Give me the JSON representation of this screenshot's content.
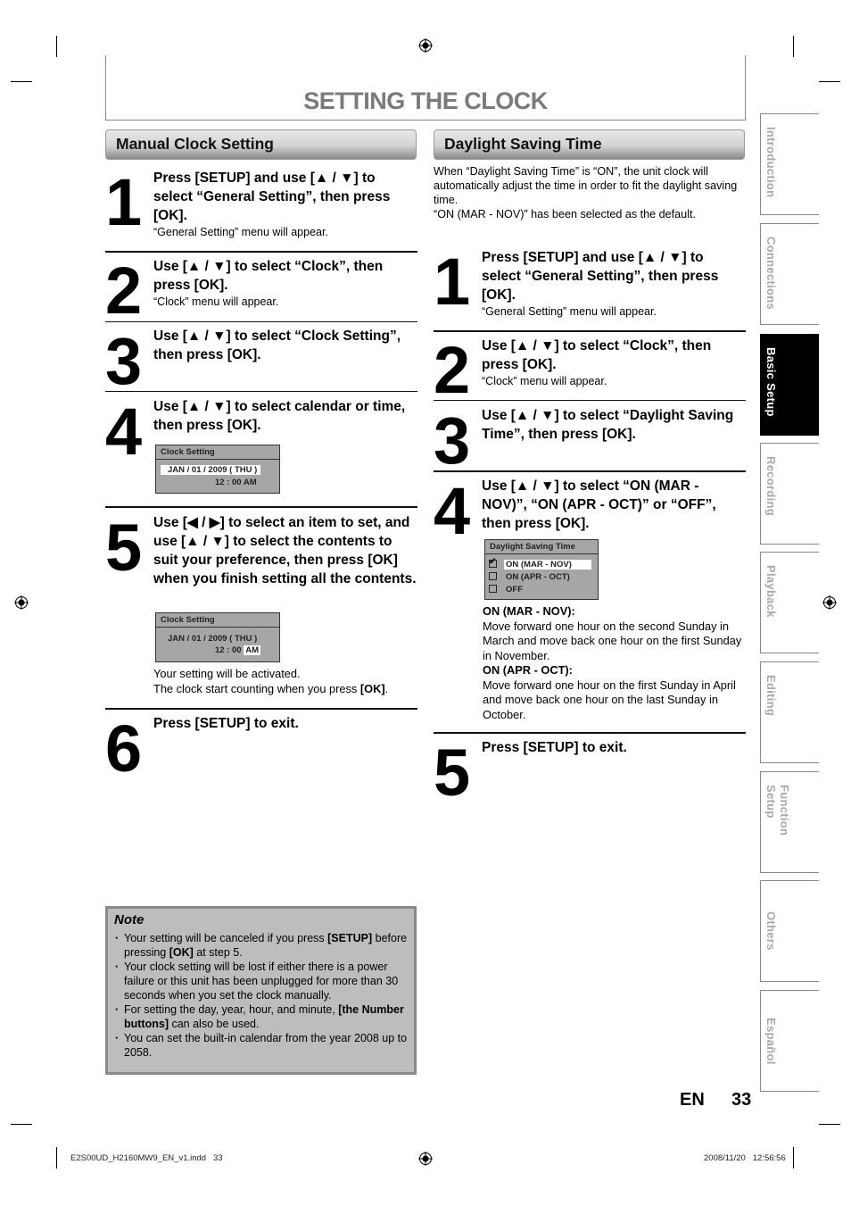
{
  "page": {
    "title": "SETTING THE CLOCK",
    "lang_label": "EN",
    "page_number": "33"
  },
  "manual": {
    "heading": "Manual Clock Setting",
    "steps": [
      {
        "num": "1",
        "text": "Press [SETUP] and use [▲ / ▼] to select “General Setting”, then press [OK].",
        "sub": "“General Setting” menu will appear."
      },
      {
        "num": "2",
        "text": "Use [▲ / ▼] to select “Clock”, then press [OK].",
        "sub": "“Clock” menu will appear."
      },
      {
        "num": "3",
        "text": "Use [▲ / ▼] to select “Clock Setting”, then press [OK].",
        "sub": ""
      },
      {
        "num": "4",
        "text": "Use [▲ / ▼] to select calendar or time, then press [OK].",
        "sub": ""
      },
      {
        "num": "5",
        "text": "Use [◀ / ▶] to select an item to set, and use [▲ / ▼] to select the contents to suit your preference, then press [OK] when you finish setting all the contents.",
        "sub": ""
      },
      {
        "num": "6",
        "text": "Press [SETUP] to exit.",
        "sub": ""
      }
    ],
    "osd4": {
      "title": "Clock Setting",
      "date": "JAN / 01 / 2009 ( THU )",
      "time_prefix": "12 : 00 ",
      "ampm": "AM"
    },
    "osd5": {
      "title": "Clock Setting",
      "date": "JAN / 01 / 2009 ( THU )",
      "time_prefix": "12 : 00 ",
      "ampm": "AM"
    },
    "step5_after_1": "Your setting will be activated.",
    "step5_after_2_prefix": "The clock start counting when you press ",
    "step5_after_2_bold": "[OK]",
    "step5_after_2_suffix": "."
  },
  "note": {
    "title": "Note",
    "items": [
      {
        "pre": "Your setting will be canceled if you press ",
        "b1": "[SETUP]",
        "mid": " before pressing ",
        "b2": "[OK]",
        "post": " at step 5."
      },
      {
        "pre": "Your clock setting will be lost if either there is a power failure or this unit has been unplugged for more than 30 seconds when you set the clock manually.",
        "b1": "",
        "mid": "",
        "b2": "",
        "post": ""
      },
      {
        "pre": "For setting the day, year, hour, and minute, ",
        "b1": "[the Number buttons]",
        "mid": " can also be used.",
        "b2": "",
        "post": ""
      },
      {
        "pre": "You can set the built-in calendar from the year 2008 up to 2058.",
        "b1": "",
        "mid": "",
        "b2": "",
        "post": ""
      }
    ]
  },
  "dst": {
    "heading": "Daylight Saving Time",
    "intro_1": "When “Daylight Saving Time” is “ON”, the unit clock will automatically adjust the time in order to fit the daylight saving time.",
    "intro_2": "“ON (MAR - NOV)” has been selected as the default.",
    "steps": [
      {
        "num": "1",
        "text": "Press [SETUP] and use [▲ / ▼] to select “General Setting”, then press [OK].",
        "sub": "“General Setting” menu will appear."
      },
      {
        "num": "2",
        "text": "Use [▲ / ▼] to select “Clock”, then press [OK].",
        "sub": "“Clock” menu will appear."
      },
      {
        "num": "3",
        "text": "Use [▲ / ▼] to select “Daylight Saving Time”, then press [OK].",
        "sub": ""
      },
      {
        "num": "4",
        "text": "Use [▲ / ▼] to select “ON (MAR - NOV)”, “ON (APR - OCT)” or “OFF”, then press [OK].",
        "sub": ""
      },
      {
        "num": "5",
        "text": "Press [SETUP] to exit.",
        "sub": ""
      }
    ],
    "osd": {
      "title": "Daylight Saving Time",
      "options": [
        {
          "label": "ON (MAR - NOV)",
          "checked": true
        },
        {
          "label": "ON (APR - OCT)",
          "checked": false
        },
        {
          "label": "OFF",
          "checked": false
        }
      ]
    },
    "opt1_title": "ON (MAR - NOV):",
    "opt1_desc": "Move forward one hour on the second Sunday in March and move back one hour on the first Sunday in November.",
    "opt2_title": "ON (APR - OCT):",
    "opt2_desc": "Move forward one hour on the first Sunday in April and move back one hour on the last Sunday in October."
  },
  "side_tabs": [
    {
      "label": "Introduction",
      "active": false
    },
    {
      "label": "Connections",
      "active": false
    },
    {
      "label": "Basic Setup",
      "active": true
    },
    {
      "label": "Recording",
      "active": false
    },
    {
      "label": "Playback",
      "active": false
    },
    {
      "label": "Editing",
      "active": false
    },
    {
      "label": "Function Setup",
      "active": false
    },
    {
      "label": "Others",
      "active": false
    },
    {
      "label": "Español",
      "active": false
    }
  ],
  "footer": {
    "file": "E2S00UD_H2160MW9_EN_v1.indd   33",
    "datetime": "2008/11/20   12:56:56"
  }
}
